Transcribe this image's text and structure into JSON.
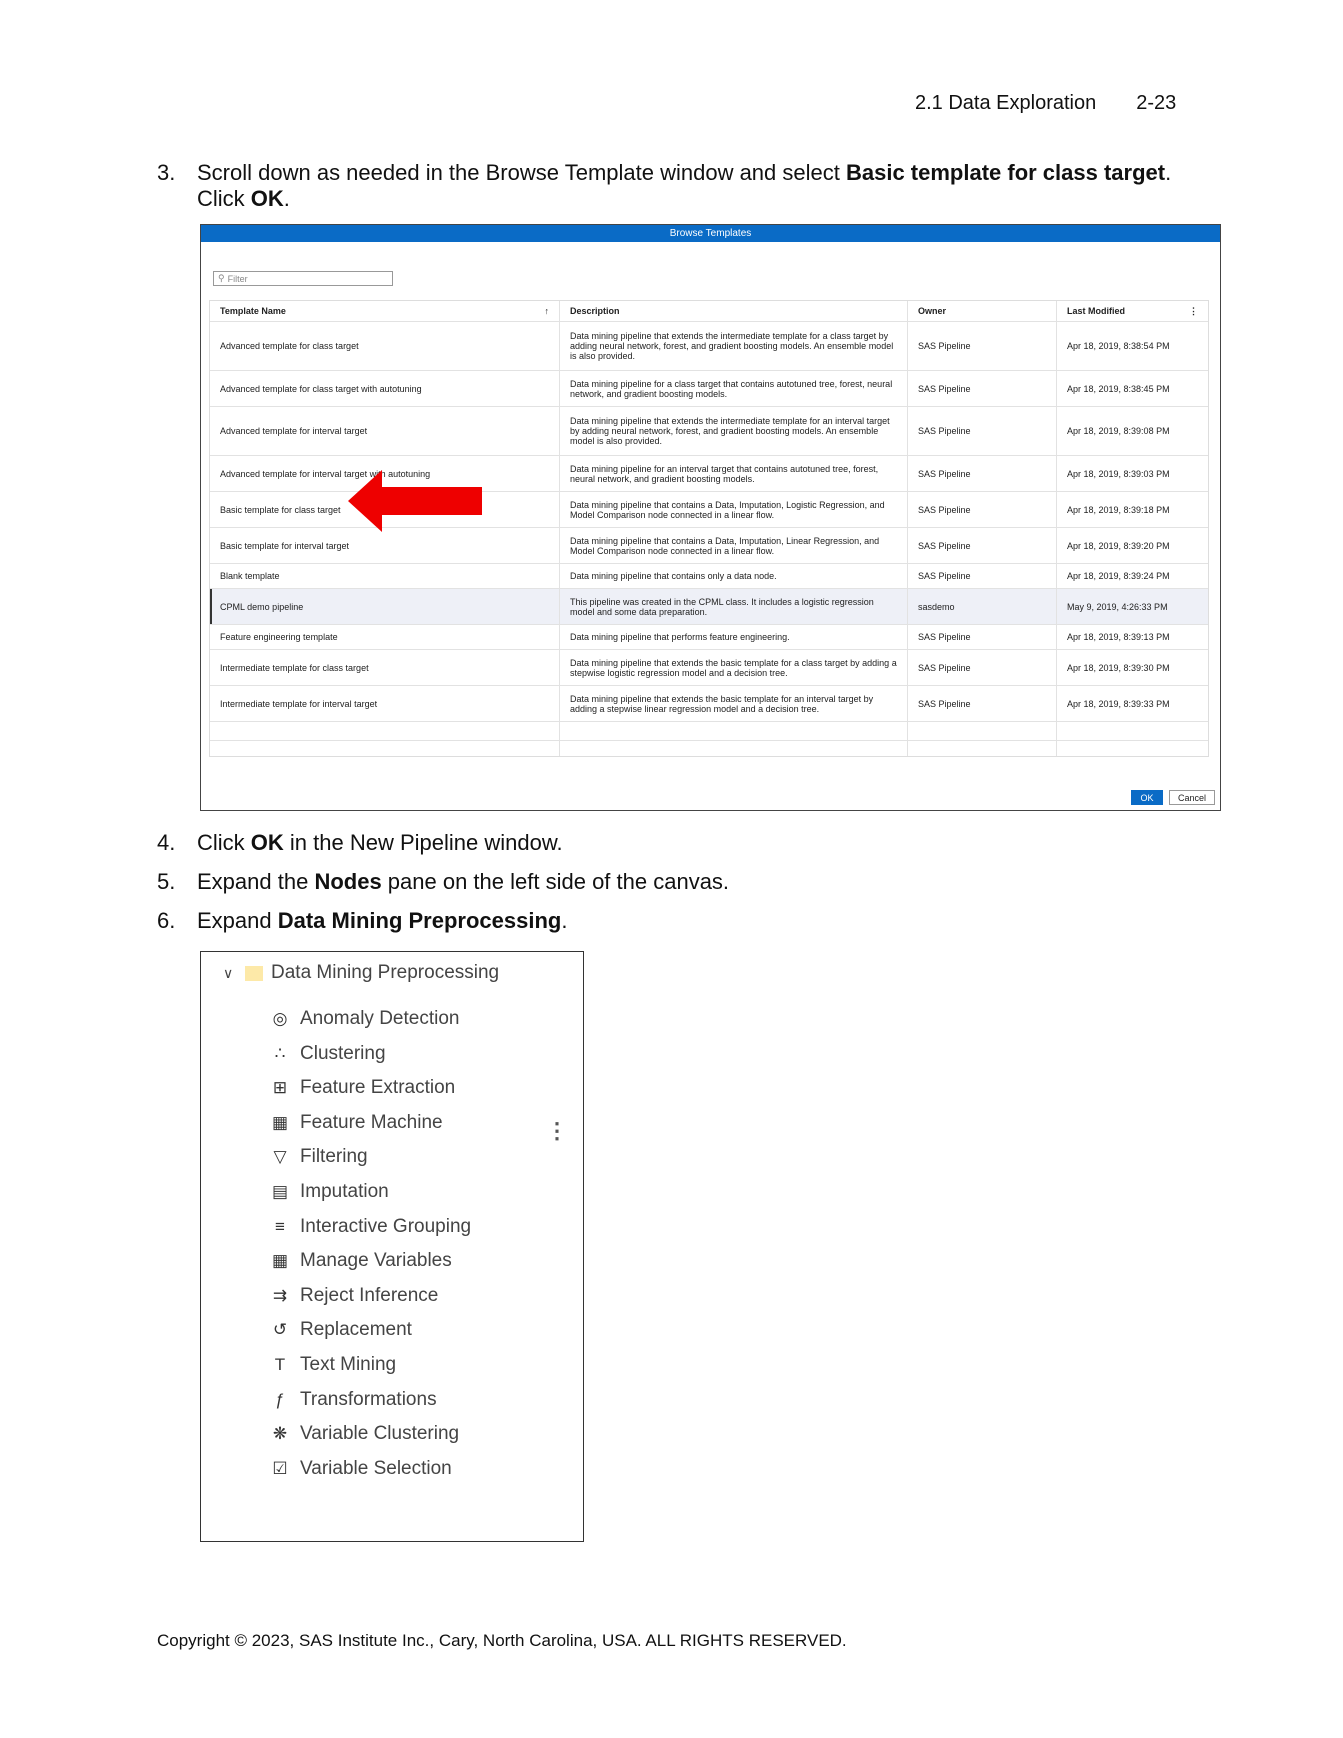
{
  "header": {
    "section": "2.1  Data Exploration",
    "page": "2-23"
  },
  "steps": [
    {
      "num": "3.",
      "pre": "Scroll down as needed in the Browse Template window and select ",
      "bold": "Basic template for class target",
      "post": ".",
      "line2_pre": "Click ",
      "line2_bold": "OK",
      "line2_post": "."
    },
    {
      "num": "4.",
      "pre": "Click ",
      "bold": "OK",
      "post": " in the New Pipeline window."
    },
    {
      "num": "5.",
      "pre": "Expand the ",
      "bold": "Nodes",
      "post": " pane on the left side of the canvas."
    },
    {
      "num": "6.",
      "pre": "Expand ",
      "bold": "Data Mining Preprocessing",
      "post": "."
    }
  ],
  "browse": {
    "title": "Browse Templates",
    "filter_placeholder": "Filter",
    "columns": [
      "Template Name",
      "Description",
      "Owner",
      "Last Modified"
    ],
    "rows": [
      {
        "name": "Advanced template for class target",
        "desc": "Data mining pipeline that extends the intermediate template for a class target by adding neural network, forest, and gradient boosting models. An ensemble model is also provided.",
        "owner": "SAS Pipeline",
        "modified": "Apr 18, 2019, 8:38:54 PM"
      },
      {
        "name": "Advanced template for class target with autotuning",
        "desc": "Data mining pipeline for a class target that contains autotuned tree, forest, neural network, and gradient boosting models.",
        "owner": "SAS Pipeline",
        "modified": "Apr 18, 2019, 8:38:45 PM"
      },
      {
        "name": "Advanced template for interval target",
        "desc": "Data mining pipeline that extends the intermediate template for an interval target by adding neural network, forest, and gradient boosting models. An ensemble model is also provided.",
        "owner": "SAS Pipeline",
        "modified": "Apr 18, 2019, 8:39:08 PM"
      },
      {
        "name": "Advanced template for interval target with autotuning",
        "desc": "Data mining pipeline for an interval target that contains autotuned tree, forest, neural network, and gradient boosting models.",
        "owner": "SAS Pipeline",
        "modified": "Apr 18, 2019, 8:39:03 PM"
      },
      {
        "name": "Basic template for class target",
        "desc": "Data mining pipeline that contains a Data, Imputation, Logistic Regression, and Model Comparison node connected in a linear flow.",
        "owner": "SAS Pipeline",
        "modified": "Apr 18, 2019, 8:39:18 PM"
      },
      {
        "name": "Basic template for interval target",
        "desc": "Data mining pipeline that contains a Data, Imputation, Linear Regression, and Model Comparison node connected in a linear flow.",
        "owner": "SAS Pipeline",
        "modified": "Apr 18, 2019, 8:39:20 PM"
      },
      {
        "name": "Blank template",
        "desc": "Data mining pipeline that contains only a data node.",
        "owner": "SAS Pipeline",
        "modified": "Apr 18, 2019, 8:39:24 PM"
      },
      {
        "name": "CPML demo pipeline",
        "desc": "This pipeline was created in the CPML class. It includes a logistic regression model and some data preparation.",
        "owner": "sasdemo",
        "modified": "May 9, 2019, 4:26:33 PM"
      },
      {
        "name": "Feature engineering template",
        "desc": "Data mining pipeline that performs feature engineering.",
        "owner": "SAS Pipeline",
        "modified": "Apr 18, 2019, 8:39:13 PM"
      },
      {
        "name": "Intermediate template for class target",
        "desc": "Data mining pipeline that extends the basic template for a class target by adding a stepwise logistic regression model and a decision tree.",
        "owner": "SAS Pipeline",
        "modified": "Apr 18, 2019, 8:39:30 PM"
      },
      {
        "name": "Intermediate template for interval target",
        "desc": "Data mining pipeline that extends the basic template for an interval target by adding a stepwise linear regression model and a decision tree.",
        "owner": "SAS Pipeline",
        "modified": "Apr 18, 2019, 8:39:33 PM"
      }
    ],
    "ok_label": "OK",
    "cancel_label": "Cancel"
  },
  "nodes": {
    "group": "Data Mining Preprocessing",
    "items": [
      {
        "label": "Anomaly Detection",
        "icon": "anomaly-icon"
      },
      {
        "label": "Clustering",
        "icon": "clustering-icon"
      },
      {
        "label": "Feature Extraction",
        "icon": "feature-extraction-icon"
      },
      {
        "label": "Feature Machine",
        "icon": "feature-machine-icon"
      },
      {
        "label": "Filtering",
        "icon": "filter-icon"
      },
      {
        "label": "Imputation",
        "icon": "imputation-icon"
      },
      {
        "label": "Interactive Grouping",
        "icon": "interactive-grouping-icon"
      },
      {
        "label": "Manage Variables",
        "icon": "table-grid-icon"
      },
      {
        "label": "Reject Inference",
        "icon": "reject-inference-icon"
      },
      {
        "label": "Replacement",
        "icon": "replacement-icon"
      },
      {
        "label": "Text Mining",
        "icon": "text-icon"
      },
      {
        "label": "Transformations",
        "icon": "function-icon"
      },
      {
        "label": "Variable Clustering",
        "icon": "asterisk-icon"
      },
      {
        "label": "Variable Selection",
        "icon": "checklist-icon"
      }
    ]
  },
  "footer": "Copyright © 2023, SAS Institute Inc., Cary, North Carolina, USA. ALL RIGHTS RESERVED."
}
